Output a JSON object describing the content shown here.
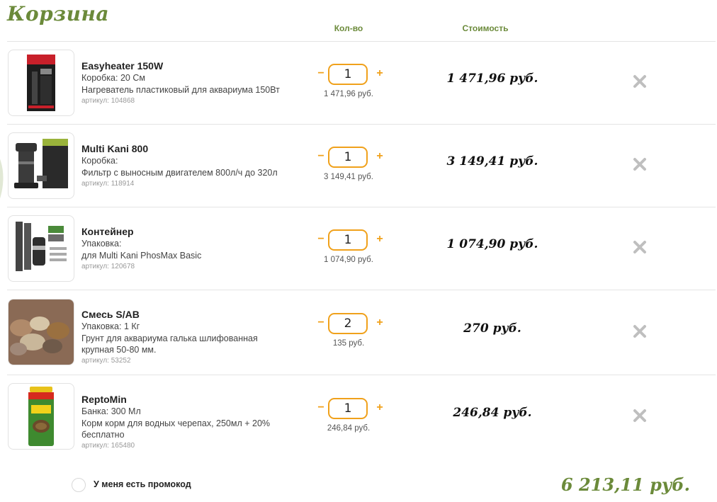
{
  "page": {
    "title": "Корзина",
    "col_qty": "Кол-во",
    "col_cost": "Стоимость"
  },
  "items": [
    {
      "name": "Easyheater 150W",
      "pack": "Коробка: 20 См",
      "desc": "Нагреватель пластиковый для аквариума 150Вт",
      "article": "артикул: 104868",
      "qty": "1",
      "unit_price": "1 471,96 руб.",
      "cost": "1 471,96 руб.",
      "image": "heater-box"
    },
    {
      "name": "Multi Kani 800",
      "pack": "Коробка:",
      "desc": "Фильтр с выносным двигателем 800л/ч до 320л",
      "article": "артикул: 118914",
      "qty": "1",
      "unit_price": "3 149,41 руб.",
      "cost": "3 149,41 руб.",
      "image": "canister-filter"
    },
    {
      "name": "Контейнер",
      "pack": "Упаковка:",
      "desc": "для Multi Kani PhosMax Basic",
      "article": "артикул: 120678",
      "qty": "1",
      "unit_price": "1 074,90 руб.",
      "cost": "1 074,90 руб.",
      "image": "container-parts"
    },
    {
      "name": "Смесь S/AB",
      "pack": "Упаковка: 1 Кг",
      "desc": "Грунт для аквариума галька шлифованная крупная 50-80 мм.",
      "article": "артикул: 53252",
      "qty": "2",
      "unit_price": "135 руб.",
      "cost": "270 руб.",
      "image": "pebbles"
    },
    {
      "name": "ReptoMin",
      "pack": "Банка: 300 Мл",
      "desc": "Корм корм для водных черепах, 250мл + 20% бесплатно",
      "article": "артикул: 165480",
      "qty": "1",
      "unit_price": "246,84 руб.",
      "cost": "246,84 руб.",
      "image": "food-can"
    }
  ],
  "promo": {
    "label": "У меня есть промокод",
    "checked": false
  },
  "total": "6 213,11 руб.",
  "colors": {
    "accent": "#6b8a3a",
    "qty_border": "#f0a11b",
    "remove": "#bfbfbf"
  },
  "icons": {
    "minus": "−",
    "plus": "+",
    "remove": "close-icon"
  }
}
